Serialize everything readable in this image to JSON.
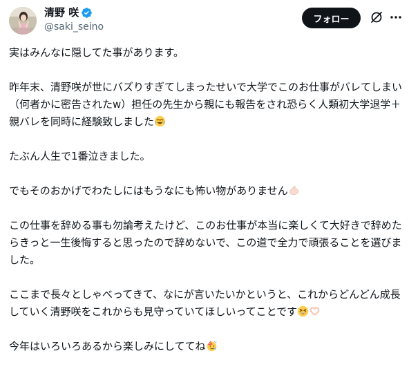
{
  "author": {
    "display_name": "清野 咲",
    "handle": "@saki_seino",
    "verified": true,
    "verified_color": "#1d9bf0"
  },
  "header": {
    "follow_label": "フォロー",
    "grok_icon": "grok-icon",
    "more_icon": "more-horizontal-icon"
  },
  "tweet": {
    "p1": "実はみんなに隠してた事があります。",
    "p2": "昨年末、清野咲が世にバズりすぎてしまったせいで大学でこのお仕事がバレてしまい（何者かに密告されたw）担任の先生から親にも報告をされ恐らく人類初大学退学＋親バレを同時に経験致しました",
    "p2_emoji": "face-with-tears-of-joy",
    "p3": "たぶん人生で1番泣きました。",
    "p4": "でもそのおかげでわたしにはもうなにも怖い物がありません",
    "p4_emoji": "flexed-biceps",
    "p5": "この仕事を辞める事も勿論考えたけど、このお仕事が本当に楽しくて大好きで辞めたらきっと一生後悔すると思ったので辞めないで、この道で全力で頑張ることを選びました。",
    "p6": "ここまで長々としゃべってきて、なにが言いたいかというと、これからどんどん成長していく清野咲をこれからも見守っていてほしいってことです",
    "p6_emoji_1": "grinning-squinting-face",
    "p6_emoji_2": "heart-hands",
    "p7": "今年はいろいろあるから楽しみにしててね",
    "p7_emoji": "partying-face"
  },
  "colors": {
    "text": "#0f1419",
    "secondary_text": "#536471",
    "follow_bg": "#0f1419",
    "follow_text": "#ffffff"
  }
}
